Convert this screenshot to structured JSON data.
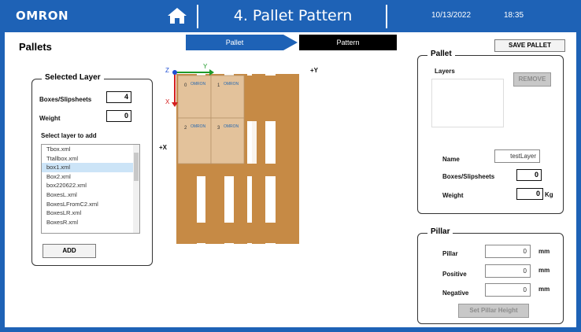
{
  "header": {
    "logo": "OMRON",
    "title": "4. Pallet Pattern",
    "date": "10/13/2022",
    "time": "18:35"
  },
  "steps": {
    "pallet": "Pallet",
    "pattern": "Pattern"
  },
  "page_title": "Pallets",
  "save_pallet_label": "SAVE PALLET",
  "selected_layer": {
    "title": "Selected Layer",
    "boxes_label": "Boxes/Slipsheets",
    "boxes_value": "4",
    "weight_label": "Weight",
    "weight_value": "0",
    "select_label": "Select layer to add",
    "items": [
      "Tbox.xml",
      "Ttallbox.xml",
      "box1.xml",
      "Box2.xml",
      "box220622.xml",
      "BoxesL.xml",
      "BoxesLFromC2.xml",
      "BoxesLR.xml",
      "BoxesR.xml"
    ],
    "selected_index": 2,
    "add_label": "ADD"
  },
  "preview": {
    "axis_z": "Z",
    "axis_y": "Y",
    "axis_x": "X",
    "plus_x": "+X",
    "plus_y": "+Y",
    "boxes": [
      {
        "index": "0",
        "brand": "OMRON"
      },
      {
        "index": "1",
        "brand": "OMRON"
      },
      {
        "index": "2",
        "brand": "OMRON"
      },
      {
        "index": "3",
        "brand": "OMRON"
      }
    ]
  },
  "pallet_panel": {
    "title": "Pallet",
    "layers_label": "Layers",
    "remove_label": "REMOVE",
    "name_label": "Name",
    "name_value": "testLayer",
    "boxes_label": "Boxes/Slipsheets",
    "boxes_value": "0",
    "weight_label": "Weight",
    "weight_value": "0",
    "weight_unit": "Kg"
  },
  "pillar_panel": {
    "title": "Pillar",
    "pillar_label": "Pillar",
    "pillar_value": "0",
    "positive_label": "Positive",
    "positive_value": "0",
    "negative_label": "Negative",
    "negative_value": "0",
    "unit": "mm",
    "set_label": "Set Pillar Height"
  },
  "colors": {
    "brand_blue": "#1e62b6",
    "wood": "#c68a45",
    "box": "#e3c29b"
  }
}
